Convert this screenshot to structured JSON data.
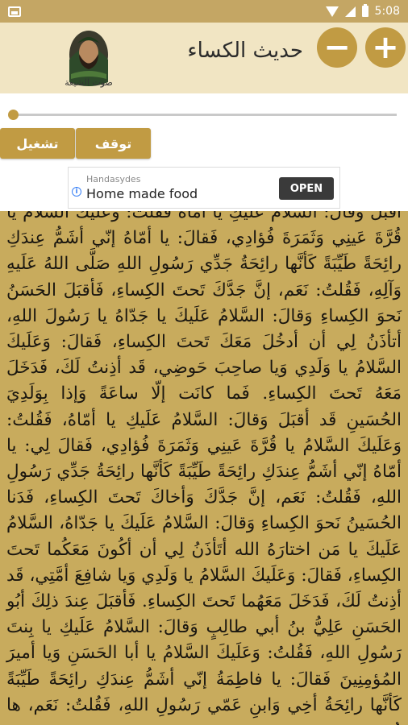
{
  "status_bar": {
    "time": "5:08"
  },
  "app": {
    "title": "حديث الكساء",
    "logo_caption": "صوت الشيعة"
  },
  "buttons": {
    "zoom_in": "+",
    "zoom_out": "−",
    "play": "تشغيل",
    "stop": "توقف"
  },
  "seek": {
    "progress": 0.0
  },
  "ad": {
    "brand": "Handasydes",
    "headline": "Home made food",
    "cta": "OPEN",
    "info": "i"
  },
  "content": {
    "text": "أقبلَ وَقالَ: السَّلامُ عَلَيكِ يا أمّاهُ فقلتُ: وَعَلَيكَ السّلامُ يا قُرَّةَ عَينِي وَثَمَرَةَ فُؤادِي، فَقالَ: يا أمّاهُ إنّي أشَمُّ عِندَكِ رائِحَةً طَيِّبَةً كَأنَّها رائِحَةُ جَدِّي رَسُولِ اللهِ صَلَّى اللهُ عَلَيهِ وَآلِهِ، فَقُلتُ: نَعَم، إنَّ جَدَّكَ تَحتَ الكِساءِ، فَأقبَلَ الحَسَنُ نَحوَ الكِساءِ وَقالَ: السَّلامُ عَلَيكَ يا جَدّاهُ يا رَسُولَ اللهِ، أتأذَنُ لِي أن أدخُلَ مَعَكَ تَحتَ الكِساءِ، فَقالَ: وَعَلَيكَ السَّلامُ يا وَلَدِي وَيا صاحِبَ حَوضِي، قَد أذِنتُ لَكَ، فَدَخَلَ مَعَهُ تَحتَ الكِساءِ. فَما كانَت إلّا ساعَةً وَإذا بِوَلَدِيَ الحُسَينِ قَد أقبَلَ وَقالَ: السَّلامُ عَلَيكِ يا أمّاهُ، فَقُلتُ: وَعَلَيكَ السَّلامُ يا قُرَّةَ عَينِي وَثَمَرَةَ فُؤادِي، فَقالَ لِي: يا أمّاهُ إنّي أشَمُّ عِندَكِ رائِحَةً طَيِّبَةً كَأنَّها رائِحَةُ جَدِّي رَسُولِ اللهِ، فَقُلتُ: نَعَم، إنَّ جَدَّكَ وَأخاكَ تَحتَ الكِساءِ، فَدَنا الحُسَينُ نَحوَ الكِساءِ وَقالَ: السَّلامُ عَلَيكَ يا جَدّاهُ، السَّلامُ عَلَيكَ يا مَن اختارَهُ الله أتَأذَنُ لِي أن أكُونَ مَعَكُما تَحتَ الكِساءِ، فَقالَ: وَعَلَيكَ السَّلامُ يا وَلَدِي وَيا شافِعَ أمَّتِي، قَد أذِنتُ لَكَ، فَدَخَلَ مَعَهُما تَحتَ الكِساءِ. فَأقبَلَ عِندَ ذلِكَ أبُو الحَسَنِ عَلِيُّ بنُ أبي طالِبٍ وَقالَ: السَّلامُ عَلَيكِ يا بِنتَ رَسُولِ اللهِ، فَقُلتُ: وَعَلَيكَ السَّلامُ يا أبا الحَسَنِ وَيا أميرَ المُؤمِنِينَ فَقالَ: يا فاطِمَةُ إنّي أشَمُّ عِندَكِ رائِحَةً طَيِّبَةً كَأنَّها رائِحَةُ أخِي وَابنِ عَمّي رَسُولِ اللهِ، فَقُلتُ: نَعَم، ها هُوَ مَعَ"
  }
}
